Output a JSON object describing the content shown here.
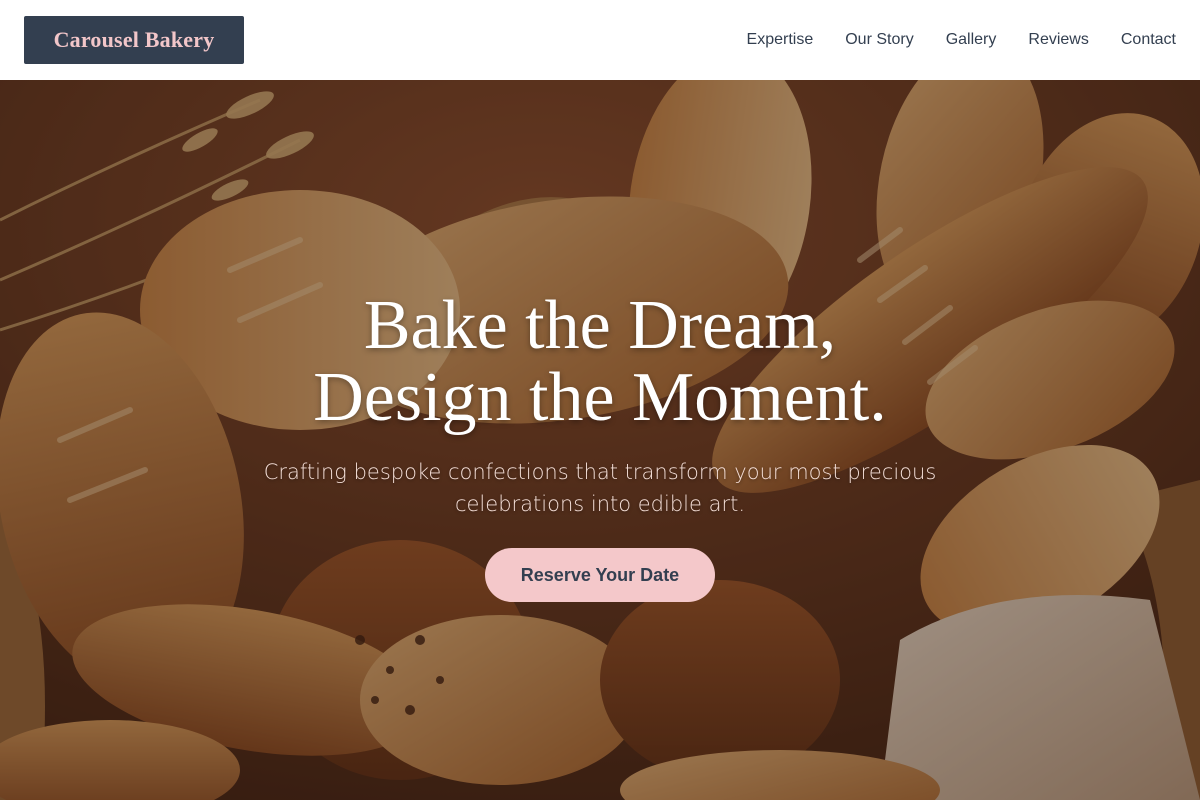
{
  "brand": {
    "name": "Carousel Bakery",
    "logo_bg": "#333f50",
    "logo_text_color": "#f2c6c9"
  },
  "nav": {
    "items": [
      {
        "label": "Expertise"
      },
      {
        "label": "Our Story"
      },
      {
        "label": "Gallery"
      },
      {
        "label": "Reviews"
      },
      {
        "label": "Contact"
      }
    ]
  },
  "hero": {
    "title_line1": "Bake the Dream,",
    "title_line2": "Design the Moment.",
    "subtitle": "Crafting bespoke confections that transform your most precious celebrations into edible art.",
    "cta_label": "Reserve Your Date",
    "cta_bg": "#f4c8ca",
    "image_subject": "bread-basket-photo"
  }
}
